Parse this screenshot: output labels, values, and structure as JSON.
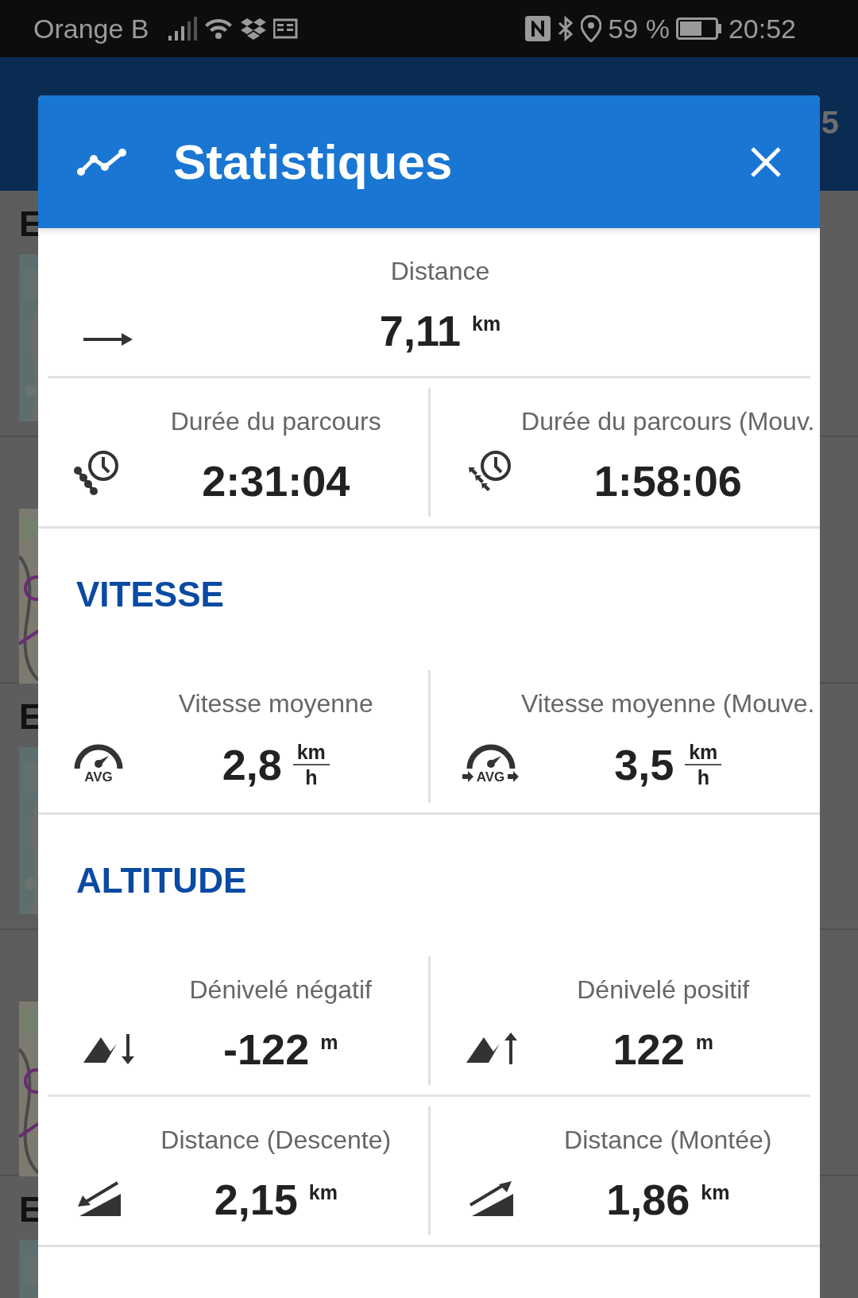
{
  "status_bar": {
    "carrier": "Orange B",
    "battery": "59 %",
    "time": "20:52"
  },
  "background": {
    "header_text": "5",
    "list": [
      {
        "kind": "picture",
        "letter": "E"
      },
      {
        "kind": "picture"
      },
      {
        "kind": "picture",
        "letter": "E"
      },
      {
        "kind": "picture"
      },
      {
        "kind": "picture",
        "letter": "E"
      }
    ]
  },
  "dialog": {
    "title": "Statistiques",
    "sections": [
      {
        "rows": [
          [
            {
              "kind": "distance",
              "label": "Distance",
              "value": "7,11",
              "unit": "km"
            }
          ],
          [
            {
              "kind": "duration",
              "label": "Durée du parcours",
              "value": "2:31:04"
            },
            {
              "kind": "duration-moving",
              "label": "Durée du parcours (Mouv.",
              "value": "1:58:06"
            }
          ]
        ]
      },
      {
        "heading": "VITESSE",
        "rows": [
          [
            {
              "kind": "speed",
              "label": "Vitesse moyenne",
              "value": "2,8",
              "unit": "km",
              "unit_per": "h",
              "icon_text": "AVG"
            },
            {
              "kind": "speed-moving",
              "label": "Vitesse moyenne (Mouve.",
              "value": "3,5",
              "unit": "km",
              "unit_per": "h",
              "icon_text": "AVG"
            }
          ]
        ]
      },
      {
        "heading": "ALTITUDE",
        "rows": [
          [
            {
              "kind": "descent",
              "label": "Dénivelé négatif",
              "value": "-122",
              "unit": "m"
            },
            {
              "kind": "ascent",
              "label": "Dénivelé positif",
              "value": "122",
              "unit": "m"
            }
          ],
          [
            {
              "kind": "descent-distance",
              "label": "Distance (Descente)",
              "value": "2,15",
              "unit": "km"
            },
            {
              "kind": "ascent-distance",
              "label": "Distance (Montée)",
              "value": "1,86",
              "unit": "km"
            }
          ]
        ]
      }
    ]
  }
}
